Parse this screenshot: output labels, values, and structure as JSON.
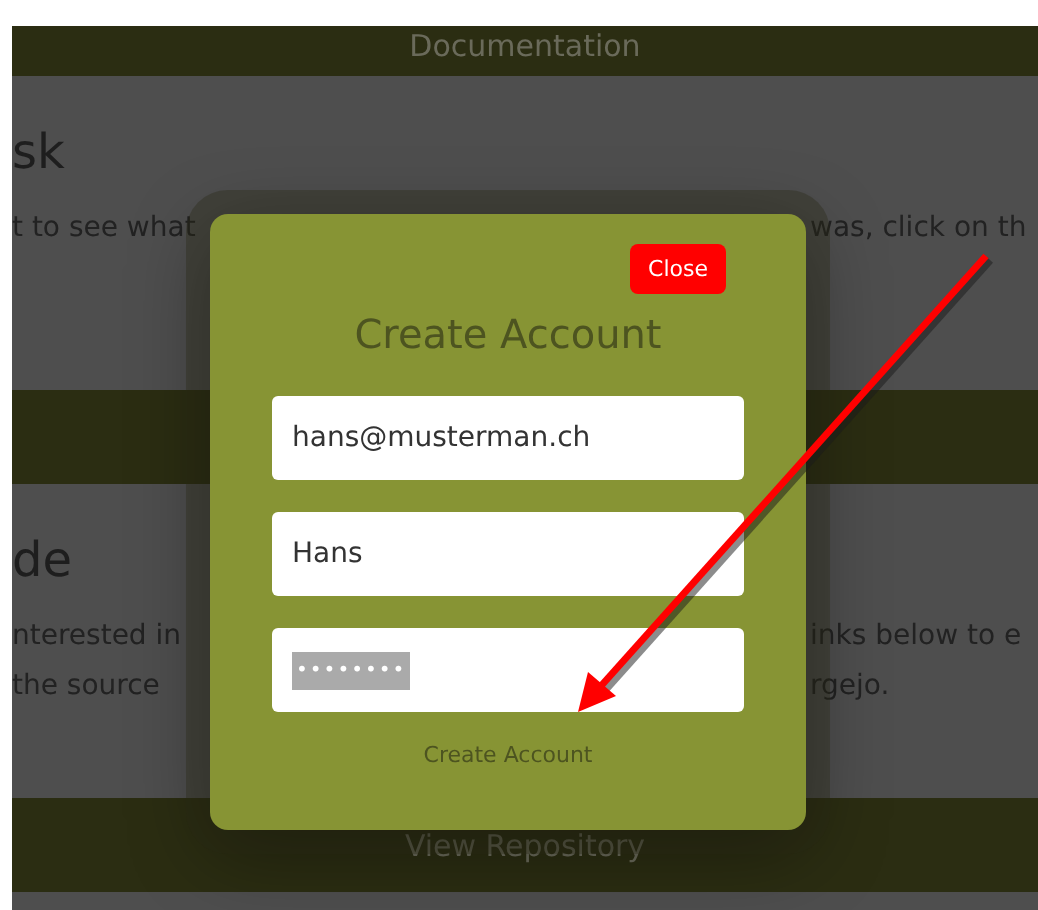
{
  "background": {
    "top_band": {
      "label": "Documentation"
    },
    "sections": [
      {
        "heading": "sk",
        "lines": [
          {
            "left": "t to see what",
            "right": "was, click on th"
          }
        ]
      },
      {
        "heading": "de",
        "lines": [
          {
            "left": "nterested in",
            "right": "inks below to e"
          },
          {
            "left": "the source",
            "right": "rgejo."
          }
        ]
      }
    ],
    "bottom_band": {
      "label": "View Repository"
    }
  },
  "dialog": {
    "title": "Create Account",
    "close_button": "Close",
    "fields": [
      {
        "kind": "text",
        "value": "hans@musterman.ch",
        "selected": false
      },
      {
        "kind": "text",
        "value": "Hans",
        "selected": false
      },
      {
        "kind": "password",
        "value": "••••••••",
        "selected": true
      }
    ],
    "submit": "Create Account"
  },
  "annotation": {
    "kind": "arrow"
  }
}
